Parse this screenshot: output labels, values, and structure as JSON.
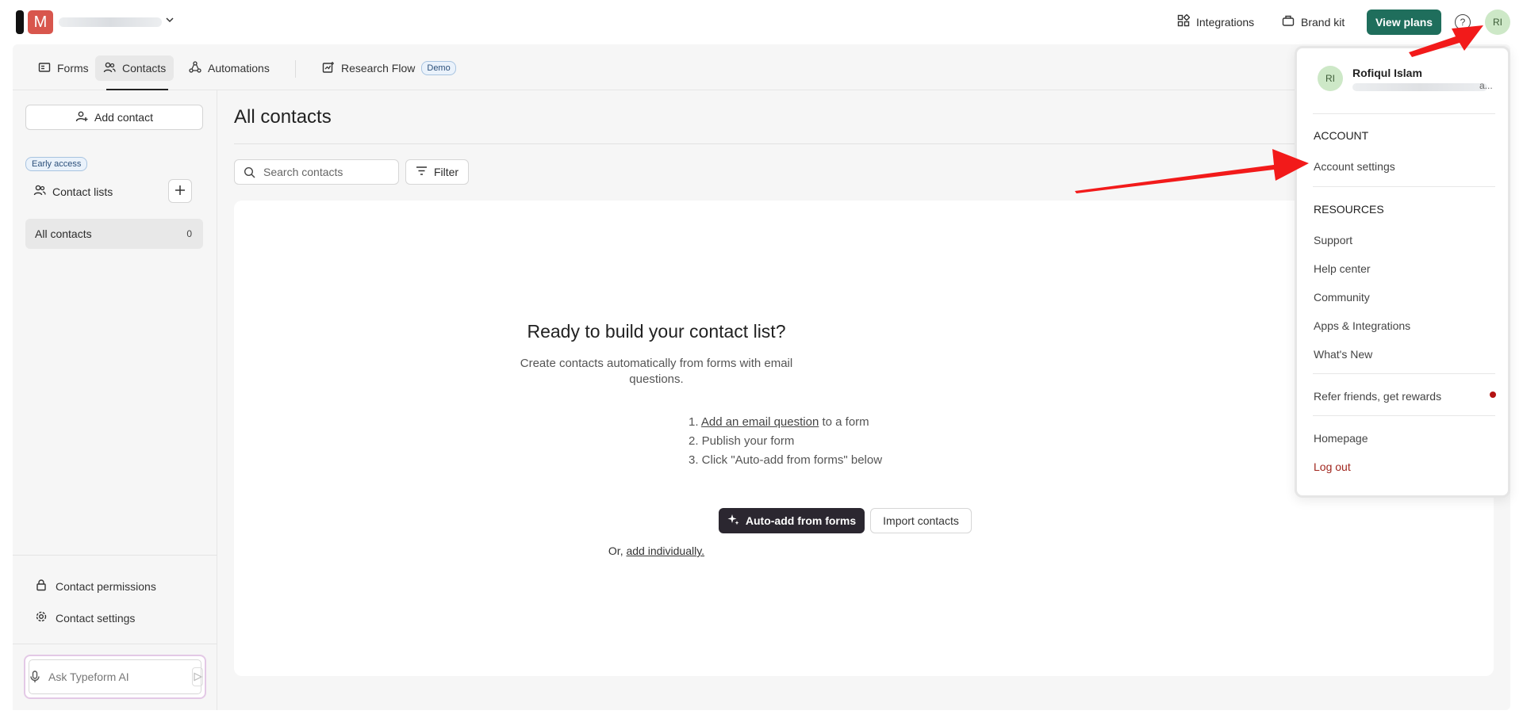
{
  "header": {
    "workspace_initial": "M",
    "integrations_label": "Integrations",
    "brandkit_label": "Brand kit",
    "viewplans_label": "View plans",
    "help_glyph": "?",
    "user_initials": "RI"
  },
  "tabs": [
    {
      "label": "Forms",
      "icon": "forms-icon"
    },
    {
      "label": "Contacts",
      "icon": "contacts-icon"
    },
    {
      "label": "Automations",
      "icon": "automations-icon"
    },
    {
      "label": "Research Flow",
      "icon": "research-flow-icon",
      "badge": "Demo"
    }
  ],
  "sidebar": {
    "add_contact_label": "Add contact",
    "early_access_label": "Early access",
    "contact_lists_label": "Contact lists",
    "all_contacts_label": "All contacts",
    "all_contacts_count": "0",
    "permissions_label": "Contact permissions",
    "settings_label": "Contact settings",
    "ai_placeholder": "Ask Typeform AI"
  },
  "main": {
    "title": "All contacts",
    "search_placeholder": "Search contacts",
    "filter_label": "Filter",
    "empty_heading": "Ready to build your contact list?",
    "empty_text": "Create contacts automatically from forms with email questions.",
    "step1_prefix": "1. ",
    "step1_link": "Add an email question",
    "step1_suffix": " to a form",
    "step2": "2. Publish your form",
    "step3": "3. Click \"Auto-add from forms\" below",
    "auto_add_label": "Auto-add from forms",
    "import_label": "Import contacts",
    "or_prefix": "Or, ",
    "or_link": "add individually."
  },
  "menu": {
    "user_initials": "RI",
    "user_name": "Rofiqul Islam",
    "email_suffix": "a...",
    "account_heading": "ACCOUNT",
    "account_settings": "Account settings",
    "resources_heading": "RESOURCES",
    "support": "Support",
    "help_center": "Help center",
    "community": "Community",
    "apps_integrations": "Apps & Integrations",
    "whats_new": "What's New",
    "refer": "Refer friends, get rewards",
    "homepage": "Homepage",
    "logout": "Log out"
  },
  "colors": {
    "brand_green": "#1f6e5c",
    "annotation_red": "#f21a1a",
    "avatar_bg": "#cde8c7"
  }
}
